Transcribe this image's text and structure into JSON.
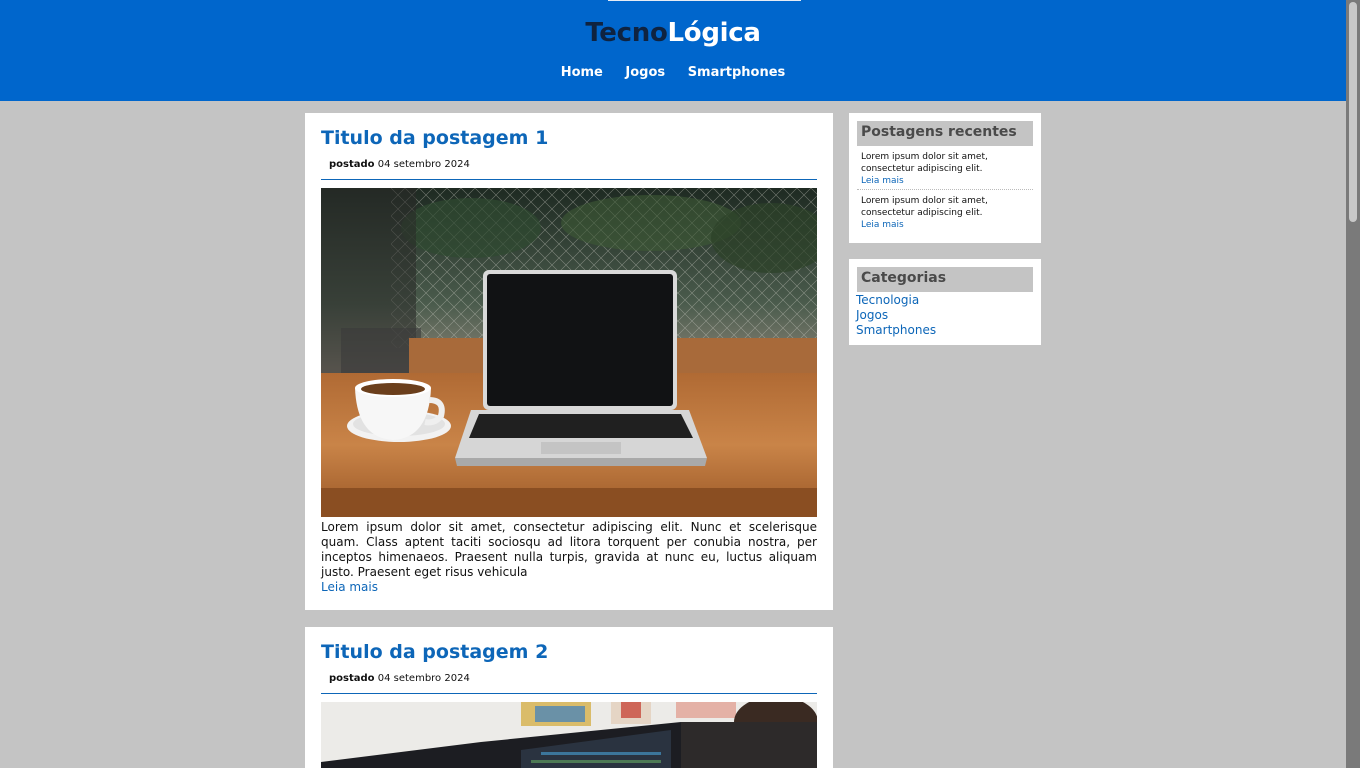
{
  "header": {
    "logo_part1": "Tecno",
    "logo_part2": "Lógica",
    "nav": [
      "Home",
      "Jogos",
      "Smartphones"
    ]
  },
  "posts": [
    {
      "title": "Titulo da postagem 1",
      "meta_label": "postado",
      "meta_date": "04 setembro 2024",
      "text": "Lorem ipsum dolor sit amet, consectetur adipiscing elit. Nunc et scelerisque quam. Class aptent taciti sociosqu ad litora torquent per conubia nostra, per inceptos himenaeos. Praesent nulla turpis, gravida at nunc eu, luctus aliquam justo. Praesent eget risus vehicula",
      "read_more": "Leia mais"
    },
    {
      "title": "Titulo da postagem 2",
      "meta_label": "postado",
      "meta_date": "04 setembro 2024"
    }
  ],
  "sidebar": {
    "recent_title": "Postagens recentes",
    "recent_items": [
      {
        "text": "Lorem ipsum dolor sit amet, consectetur adipiscing elit.",
        "link": "Leia mais"
      },
      {
        "text": "Lorem ipsum dolor sit amet, consectetur adipiscing elit.",
        "link": "Leia mais"
      }
    ],
    "categories_title": "Categorias",
    "categories": [
      "Tecnologia",
      "Jogos",
      "Smartphones"
    ]
  },
  "colors": {
    "header_bg": "#0066cc",
    "page_bg": "#c4c4c4",
    "link": "#0d66b8"
  }
}
